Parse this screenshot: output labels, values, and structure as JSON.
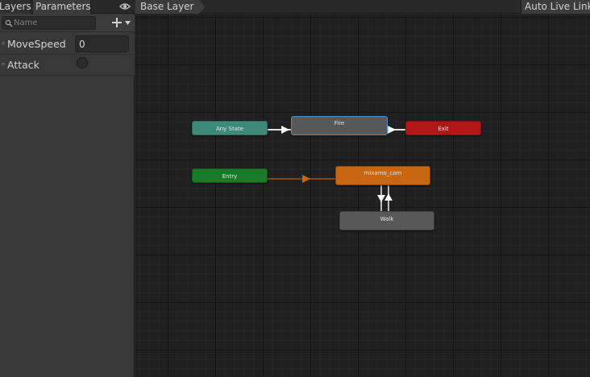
{
  "panel": {
    "tabs": [
      {
        "label": "Layers"
      },
      {
        "label": "Parameters"
      }
    ],
    "search": {
      "placeholder": "Name",
      "value": ""
    },
    "parameters": [
      {
        "name": "MoveSpeed",
        "type": "float",
        "value": "0"
      },
      {
        "name": "Attack",
        "type": "trigger",
        "set": false
      }
    ]
  },
  "graph": {
    "breadcrumb": "Base Layer",
    "auto_live_link_label": "Auto Live Link",
    "states": [
      {
        "name": "Any State",
        "kind": "any-state",
        "color": "#3d8a78"
      },
      {
        "name": "Fire",
        "kind": "state",
        "color": "#585858",
        "selected": true
      },
      {
        "name": "Exit",
        "kind": "exit",
        "color": "#b01818"
      },
      {
        "name": "Entry",
        "kind": "entry",
        "color": "#197a28"
      },
      {
        "name": "mixamo_com",
        "kind": "default-state",
        "color": "#c8670f"
      },
      {
        "name": "Walk",
        "kind": "state",
        "color": "#585858"
      }
    ],
    "transitions": [
      {
        "from": "Any State",
        "to": "Fire"
      },
      {
        "from": "Fire",
        "to": "Exit"
      },
      {
        "from": "Entry",
        "to": "mixamo_com",
        "default": true
      },
      {
        "from": "mixamo_com",
        "to": "Walk"
      },
      {
        "from": "Walk",
        "to": "mixamo_com"
      }
    ]
  },
  "icons": {
    "eye": "eye-icon",
    "search": "search-icon",
    "add": "plus-icon",
    "dropdown": "chevron-down-icon"
  },
  "colors": {
    "selection": "#4e8fd6",
    "default_transition": "#c8670f",
    "transition": "#e0e0e0"
  }
}
